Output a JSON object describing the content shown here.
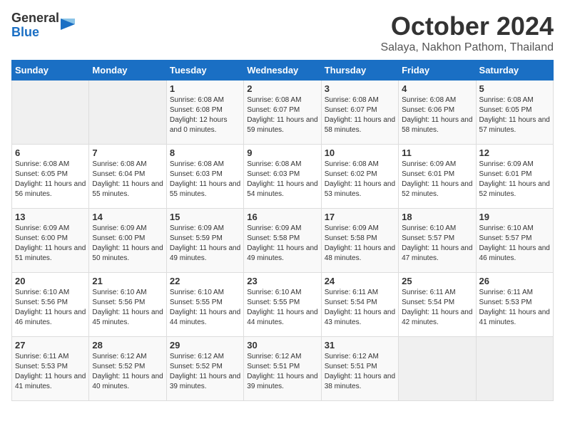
{
  "header": {
    "logo_general": "General",
    "logo_blue": "Blue",
    "month_title": "October 2024",
    "location": "Salaya, Nakhon Pathom, Thailand"
  },
  "weekdays": [
    "Sunday",
    "Monday",
    "Tuesday",
    "Wednesday",
    "Thursday",
    "Friday",
    "Saturday"
  ],
  "weeks": [
    [
      {
        "day": "",
        "sunrise": "",
        "sunset": "",
        "daylight": ""
      },
      {
        "day": "",
        "sunrise": "",
        "sunset": "",
        "daylight": ""
      },
      {
        "day": "1",
        "sunrise": "Sunrise: 6:08 AM",
        "sunset": "Sunset: 6:08 PM",
        "daylight": "Daylight: 12 hours and 0 minutes."
      },
      {
        "day": "2",
        "sunrise": "Sunrise: 6:08 AM",
        "sunset": "Sunset: 6:07 PM",
        "daylight": "Daylight: 11 hours and 59 minutes."
      },
      {
        "day": "3",
        "sunrise": "Sunrise: 6:08 AM",
        "sunset": "Sunset: 6:07 PM",
        "daylight": "Daylight: 11 hours and 58 minutes."
      },
      {
        "day": "4",
        "sunrise": "Sunrise: 6:08 AM",
        "sunset": "Sunset: 6:06 PM",
        "daylight": "Daylight: 11 hours and 58 minutes."
      },
      {
        "day": "5",
        "sunrise": "Sunrise: 6:08 AM",
        "sunset": "Sunset: 6:05 PM",
        "daylight": "Daylight: 11 hours and 57 minutes."
      }
    ],
    [
      {
        "day": "6",
        "sunrise": "Sunrise: 6:08 AM",
        "sunset": "Sunset: 6:05 PM",
        "daylight": "Daylight: 11 hours and 56 minutes."
      },
      {
        "day": "7",
        "sunrise": "Sunrise: 6:08 AM",
        "sunset": "Sunset: 6:04 PM",
        "daylight": "Daylight: 11 hours and 55 minutes."
      },
      {
        "day": "8",
        "sunrise": "Sunrise: 6:08 AM",
        "sunset": "Sunset: 6:03 PM",
        "daylight": "Daylight: 11 hours and 55 minutes."
      },
      {
        "day": "9",
        "sunrise": "Sunrise: 6:08 AM",
        "sunset": "Sunset: 6:03 PM",
        "daylight": "Daylight: 11 hours and 54 minutes."
      },
      {
        "day": "10",
        "sunrise": "Sunrise: 6:08 AM",
        "sunset": "Sunset: 6:02 PM",
        "daylight": "Daylight: 11 hours and 53 minutes."
      },
      {
        "day": "11",
        "sunrise": "Sunrise: 6:09 AM",
        "sunset": "Sunset: 6:01 PM",
        "daylight": "Daylight: 11 hours and 52 minutes."
      },
      {
        "day": "12",
        "sunrise": "Sunrise: 6:09 AM",
        "sunset": "Sunset: 6:01 PM",
        "daylight": "Daylight: 11 hours and 52 minutes."
      }
    ],
    [
      {
        "day": "13",
        "sunrise": "Sunrise: 6:09 AM",
        "sunset": "Sunset: 6:00 PM",
        "daylight": "Daylight: 11 hours and 51 minutes."
      },
      {
        "day": "14",
        "sunrise": "Sunrise: 6:09 AM",
        "sunset": "Sunset: 6:00 PM",
        "daylight": "Daylight: 11 hours and 50 minutes."
      },
      {
        "day": "15",
        "sunrise": "Sunrise: 6:09 AM",
        "sunset": "Sunset: 5:59 PM",
        "daylight": "Daylight: 11 hours and 49 minutes."
      },
      {
        "day": "16",
        "sunrise": "Sunrise: 6:09 AM",
        "sunset": "Sunset: 5:58 PM",
        "daylight": "Daylight: 11 hours and 49 minutes."
      },
      {
        "day": "17",
        "sunrise": "Sunrise: 6:09 AM",
        "sunset": "Sunset: 5:58 PM",
        "daylight": "Daylight: 11 hours and 48 minutes."
      },
      {
        "day": "18",
        "sunrise": "Sunrise: 6:10 AM",
        "sunset": "Sunset: 5:57 PM",
        "daylight": "Daylight: 11 hours and 47 minutes."
      },
      {
        "day": "19",
        "sunrise": "Sunrise: 6:10 AM",
        "sunset": "Sunset: 5:57 PM",
        "daylight": "Daylight: 11 hours and 46 minutes."
      }
    ],
    [
      {
        "day": "20",
        "sunrise": "Sunrise: 6:10 AM",
        "sunset": "Sunset: 5:56 PM",
        "daylight": "Daylight: 11 hours and 46 minutes."
      },
      {
        "day": "21",
        "sunrise": "Sunrise: 6:10 AM",
        "sunset": "Sunset: 5:56 PM",
        "daylight": "Daylight: 11 hours and 45 minutes."
      },
      {
        "day": "22",
        "sunrise": "Sunrise: 6:10 AM",
        "sunset": "Sunset: 5:55 PM",
        "daylight": "Daylight: 11 hours and 44 minutes."
      },
      {
        "day": "23",
        "sunrise": "Sunrise: 6:10 AM",
        "sunset": "Sunset: 5:55 PM",
        "daylight": "Daylight: 11 hours and 44 minutes."
      },
      {
        "day": "24",
        "sunrise": "Sunrise: 6:11 AM",
        "sunset": "Sunset: 5:54 PM",
        "daylight": "Daylight: 11 hours and 43 minutes."
      },
      {
        "day": "25",
        "sunrise": "Sunrise: 6:11 AM",
        "sunset": "Sunset: 5:54 PM",
        "daylight": "Daylight: 11 hours and 42 minutes."
      },
      {
        "day": "26",
        "sunrise": "Sunrise: 6:11 AM",
        "sunset": "Sunset: 5:53 PM",
        "daylight": "Daylight: 11 hours and 41 minutes."
      }
    ],
    [
      {
        "day": "27",
        "sunrise": "Sunrise: 6:11 AM",
        "sunset": "Sunset: 5:53 PM",
        "daylight": "Daylight: 11 hours and 41 minutes."
      },
      {
        "day": "28",
        "sunrise": "Sunrise: 6:12 AM",
        "sunset": "Sunset: 5:52 PM",
        "daylight": "Daylight: 11 hours and 40 minutes."
      },
      {
        "day": "29",
        "sunrise": "Sunrise: 6:12 AM",
        "sunset": "Sunset: 5:52 PM",
        "daylight": "Daylight: 11 hours and 39 minutes."
      },
      {
        "day": "30",
        "sunrise": "Sunrise: 6:12 AM",
        "sunset": "Sunset: 5:51 PM",
        "daylight": "Daylight: 11 hours and 39 minutes."
      },
      {
        "day": "31",
        "sunrise": "Sunrise: 6:12 AM",
        "sunset": "Sunset: 5:51 PM",
        "daylight": "Daylight: 11 hours and 38 minutes."
      },
      {
        "day": "",
        "sunrise": "",
        "sunset": "",
        "daylight": ""
      },
      {
        "day": "",
        "sunrise": "",
        "sunset": "",
        "daylight": ""
      }
    ]
  ]
}
